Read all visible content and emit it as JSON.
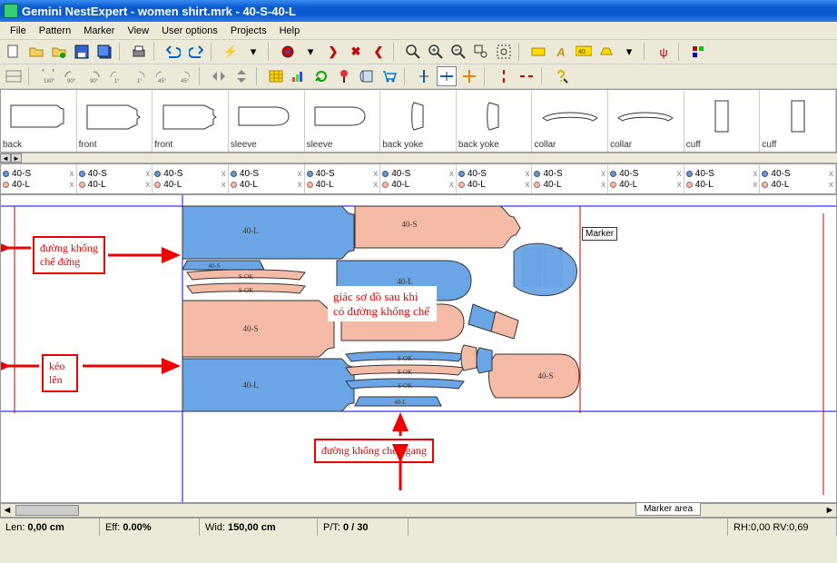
{
  "title": "Gemini NestExpert - women shirt.mrk - 40-S-40-L",
  "menu": [
    "File",
    "Pattern",
    "Marker",
    "View",
    "User options",
    "Projects",
    "Help"
  ],
  "pieces": [
    {
      "label": "back"
    },
    {
      "label": "front"
    },
    {
      "label": "front"
    },
    {
      "label": "sleeve"
    },
    {
      "label": "sleeve"
    },
    {
      "label": "back yoke"
    },
    {
      "label": "back yoke"
    },
    {
      "label": "collar"
    },
    {
      "label": "collar"
    },
    {
      "label": "cuff"
    },
    {
      "label": "cuff"
    }
  ],
  "sizes": {
    "s": "40-S",
    "l": "40-L",
    "x": "x"
  },
  "marker_label": "Marker",
  "scrolltab_label": "Marker area",
  "annotations": {
    "vert_line": "đường khống chế đứng",
    "pull_up": "kéo lên",
    "after": "giác sơ đồ sau khi có đường khống chế",
    "horiz_line": "đường khống chế ngang"
  },
  "piece_names": {
    "s": "40-S",
    "l": "40-L",
    "sok": "S-OK"
  },
  "status": {
    "len_label": "Len:",
    "len_val": "0,00 cm",
    "eff_label": "Eff:",
    "eff_val": "0.00%",
    "wid_label": "Wid:",
    "wid_val": "150,00 cm",
    "pt_label": "P/T:",
    "pt_val": "0 / 30",
    "rh": "RH:0,00 RV:0,69"
  }
}
